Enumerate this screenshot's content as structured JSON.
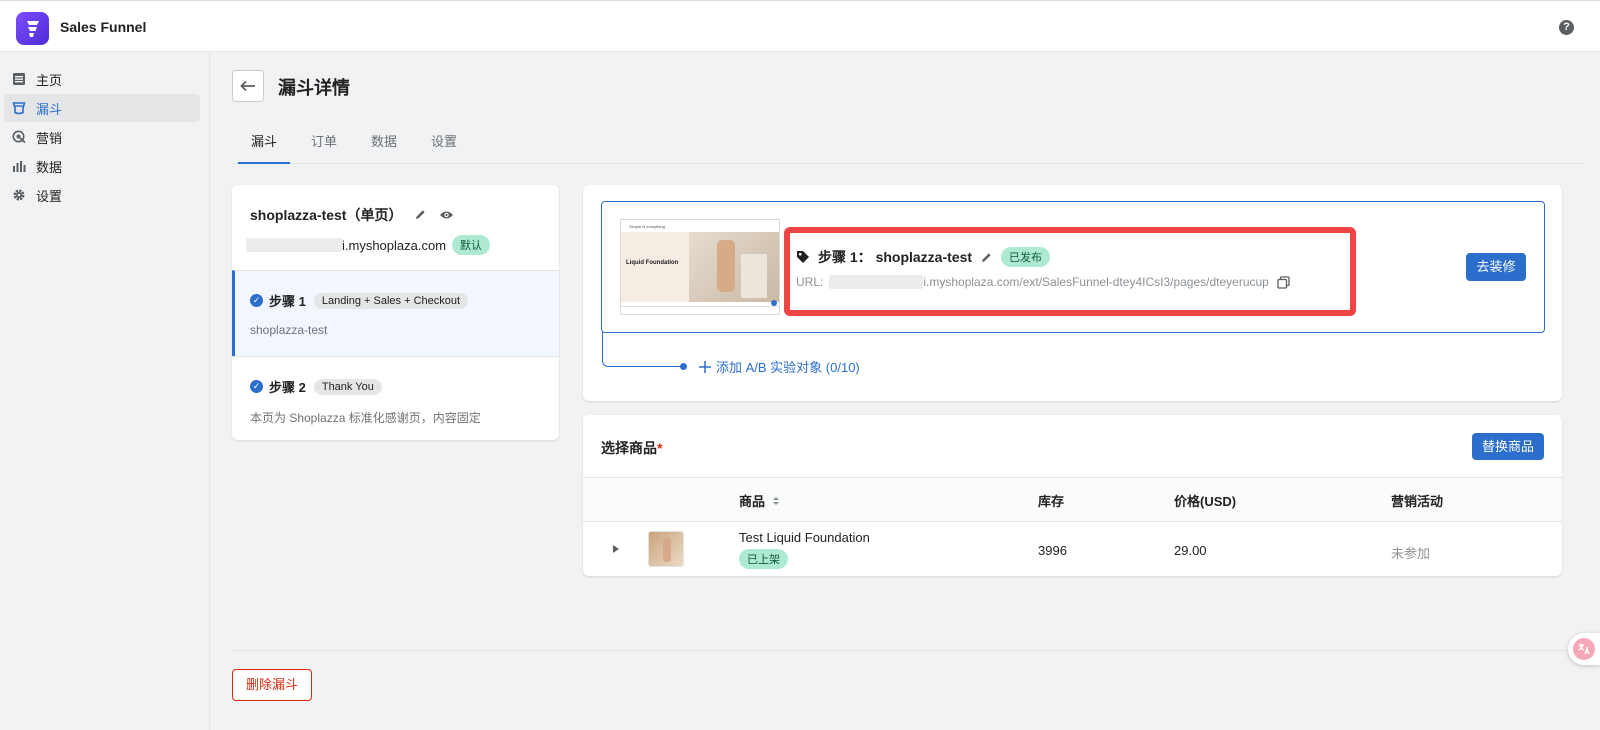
{
  "app": {
    "title": "Sales Funnel",
    "help_icon": "help-icon"
  },
  "sidebar": {
    "items": [
      {
        "label": "主页",
        "icon": "list-icon",
        "active": false
      },
      {
        "label": "漏斗",
        "icon": "funnel-icon",
        "active": true
      },
      {
        "label": "营销",
        "icon": "target-icon",
        "active": false
      },
      {
        "label": "数据",
        "icon": "bar-chart-icon",
        "active": false
      },
      {
        "label": "设置",
        "icon": "gear-icon",
        "active": false
      }
    ]
  },
  "page": {
    "title": "漏斗详情",
    "tabs": [
      {
        "label": "漏斗",
        "active": true
      },
      {
        "label": "订单",
        "active": false
      },
      {
        "label": "数据",
        "active": false
      },
      {
        "label": "设置",
        "active": false
      }
    ]
  },
  "funnel": {
    "name": "shoplazza-test（单页）",
    "domain": "i.myshoplaza.com",
    "default_badge": "默认",
    "steps": [
      {
        "label": "步骤 1",
        "tag": "Landing + Sales + Checkout",
        "desc": "shoplazza-test"
      },
      {
        "label": "步骤 2",
        "tag": "Thank You",
        "desc": "本页为 Shoplazza 标准化感谢页，内容固定"
      }
    ]
  },
  "step_detail": {
    "title": "步骤 1： shoplazza-test",
    "status": "已发布",
    "url_label": "URL:",
    "url": "i.myshoplaza.com/ext/SalesFunnel-dtey4ICsI3/pages/dteyerucup",
    "decorate_button": "去装修",
    "ab_test_link": "添加 A/B 实验对象 (0/10)",
    "thumbnail": {
      "top_text": "Simple is everything",
      "headline": "Liquid Foundation"
    }
  },
  "products": {
    "title": "选择商品",
    "required_mark": "*",
    "replace_button": "替换商品",
    "columns": [
      "商品",
      "库存",
      "价格(USD)",
      "营销活动"
    ],
    "rows": [
      {
        "name": "Test Liquid Foundation",
        "status": "已上架",
        "stock": "3996",
        "price": "29.00",
        "campaign": "未参加"
      }
    ]
  },
  "footer": {
    "delete_button": "删除漏斗"
  },
  "colors": {
    "accent": "#2c6ecb",
    "danger": "#d72c0d",
    "highlight": "#f04545",
    "success_bg": "#aee9d1"
  }
}
